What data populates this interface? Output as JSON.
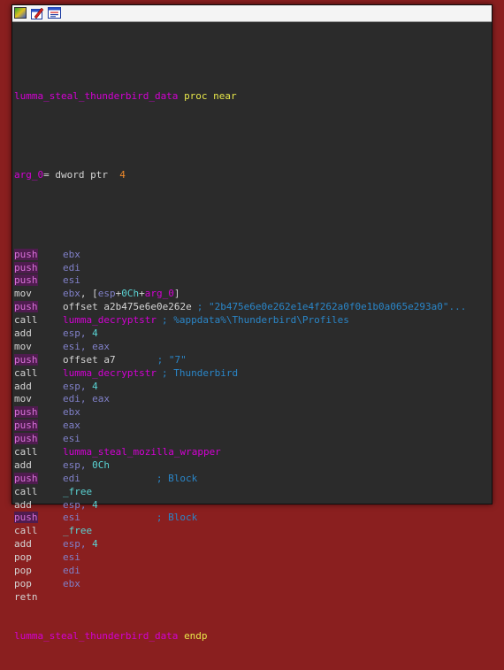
{
  "toolbar": {
    "icons": [
      "graph-overview-icon",
      "edit-graph-icon",
      "print-graph-icon"
    ]
  },
  "proc": {
    "name": "lumma_steal_thunderbird_data",
    "proc_kw": "proc near",
    "endp_kw": "endp"
  },
  "arg": {
    "name": "arg_0",
    "eq": "=",
    "type": " dword ptr  ",
    "value": "4"
  },
  "instructions": [
    {
      "m": "push",
      "ops": "ebx"
    },
    {
      "m": "push",
      "ops": "edi"
    },
    {
      "m": "push",
      "ops": "esi"
    },
    {
      "m": "mov",
      "ops": "ebx, [esp+0Ch+arg_0]"
    },
    {
      "m": "push",
      "ops": "offset a2b475e6e0e262e",
      "cmt": "; \"2b475e6e0e262e1e4f262a0f0e1b0a065e293a0\"..."
    },
    {
      "m": "call",
      "ops": "lumma_decryptstr",
      "cmt": "; %appdata%\\Thunderbird\\Profiles"
    },
    {
      "m": "add",
      "ops": "esp, 4"
    },
    {
      "m": "mov",
      "ops": "esi, eax"
    },
    {
      "m": "push",
      "ops": "offset a7",
      "cmt": "; \"7\""
    },
    {
      "m": "call",
      "ops": "lumma_decryptstr",
      "cmt": "; Thunderbird"
    },
    {
      "m": "add",
      "ops": "esp, 4"
    },
    {
      "m": "mov",
      "ops": "edi, eax"
    },
    {
      "m": "push",
      "ops": "ebx"
    },
    {
      "m": "push",
      "ops": "eax"
    },
    {
      "m": "push",
      "ops": "esi"
    },
    {
      "m": "call",
      "ops": "lumma_steal_mozilla_wrapper"
    },
    {
      "m": "add",
      "ops": "esp, 0Ch"
    },
    {
      "m": "push",
      "ops": "edi",
      "cmt": "; Block"
    },
    {
      "m": "call",
      "ops": "_free"
    },
    {
      "m": "add",
      "ops": "esp, 4"
    },
    {
      "m": "push",
      "ops": "esi",
      "cmt": "; Block"
    },
    {
      "m": "call",
      "ops": "_free"
    },
    {
      "m": "add",
      "ops": "esp, 4"
    },
    {
      "m": "pop",
      "ops": "esi"
    },
    {
      "m": "pop",
      "ops": "edi"
    },
    {
      "m": "pop",
      "ops": "ebx"
    },
    {
      "m": "retn",
      "ops": ""
    }
  ]
}
